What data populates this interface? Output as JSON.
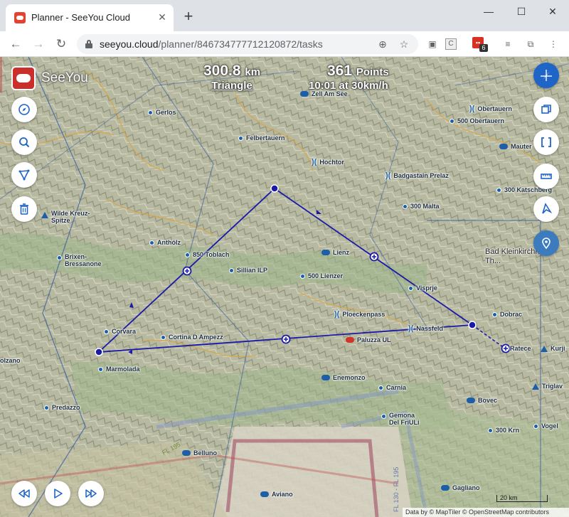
{
  "browser": {
    "tab_title": "Planner - SeeYou Cloud",
    "url_host": "seeyou.cloud",
    "url_path": "/planner/846734777712120872/tasks",
    "extension_badge": "6"
  },
  "app": {
    "name": "SeeYou"
  },
  "task": {
    "distance_value": "300.8",
    "distance_unit": "km",
    "task_type": "Triangle",
    "points_value": "361",
    "points_unit": "Points",
    "duration": "10:01 at 30km/h"
  },
  "map": {
    "places": [
      {
        "label": "Gerlos",
        "kind": "dot"
      },
      {
        "label": "Felbertauern",
        "kind": "dot"
      },
      {
        "label": "Hochtor",
        "kind": "pass"
      },
      {
        "label": "Zell Am See",
        "kind": "air"
      },
      {
        "label": "Obertauern",
        "kind": "pass"
      },
      {
        "label": "500 Obertauern",
        "kind": "dot"
      },
      {
        "label": "Mauter",
        "kind": "air"
      },
      {
        "label": "Badgastain Prelaz",
        "kind": "pass"
      },
      {
        "label": "300 Katschberg",
        "kind": "dot"
      },
      {
        "label": "300 Malta",
        "kind": "dot"
      },
      {
        "label": "Wilde Kreuz-\nSpitze",
        "kind": "tri"
      },
      {
        "label": "Anthólz",
        "kind": "dot"
      },
      {
        "label": "850 Toblach",
        "kind": "dot"
      },
      {
        "label": "Sillian ILP",
        "kind": "dot"
      },
      {
        "label": "Lienz",
        "kind": "air"
      },
      {
        "label": "Bad Kleinkirchheim: Th...",
        "kind": "dot"
      },
      {
        "label": "Brixen-\nBressanone",
        "kind": "dot"
      },
      {
        "label": "500 Lienzer",
        "kind": "dot"
      },
      {
        "label": "Visprje",
        "kind": "dot"
      },
      {
        "label": "Ploeckenpass",
        "kind": "pass"
      },
      {
        "label": "Dobrac",
        "kind": "dot"
      },
      {
        "label": "Nassfeld",
        "kind": "pass"
      },
      {
        "label": "Corvara",
        "kind": "dot"
      },
      {
        "label": "Cortina D Ampezz",
        "kind": "dot"
      },
      {
        "label": "Paluzza UL",
        "kind": "air-red"
      },
      {
        "label": "Ratece",
        "kind": "dot"
      },
      {
        "label": "Kurji",
        "kind": "tri"
      },
      {
        "label": "olzano",
        "kind": "none"
      },
      {
        "label": "Marmolada",
        "kind": "dot"
      },
      {
        "label": "Enemonzo",
        "kind": "air"
      },
      {
        "label": "Carnia",
        "kind": "dot"
      },
      {
        "label": "Triglav",
        "kind": "tri"
      },
      {
        "label": "Predazzo",
        "kind": "dot"
      },
      {
        "label": "Bovec",
        "kind": "air"
      },
      {
        "label": "Gemona\nDel FriULi",
        "kind": "dot"
      },
      {
        "label": "300 Krn",
        "kind": "dot"
      },
      {
        "label": "Vogel",
        "kind": "dot"
      },
      {
        "label": "Belluno",
        "kind": "air"
      },
      {
        "label": "Aviano",
        "kind": "air"
      },
      {
        "label": "Gagliano",
        "kind": "air"
      }
    ],
    "airspace_labels": [
      "FL 195",
      "FL 130 - FL 195"
    ],
    "scale_label": "20 km",
    "attribution": "Data by © MapTiler © OpenStreetMap contributors"
  },
  "colors": {
    "accent": "#1f64c7",
    "task_line": "#1a1aa8",
    "brand": "#c9302c"
  }
}
